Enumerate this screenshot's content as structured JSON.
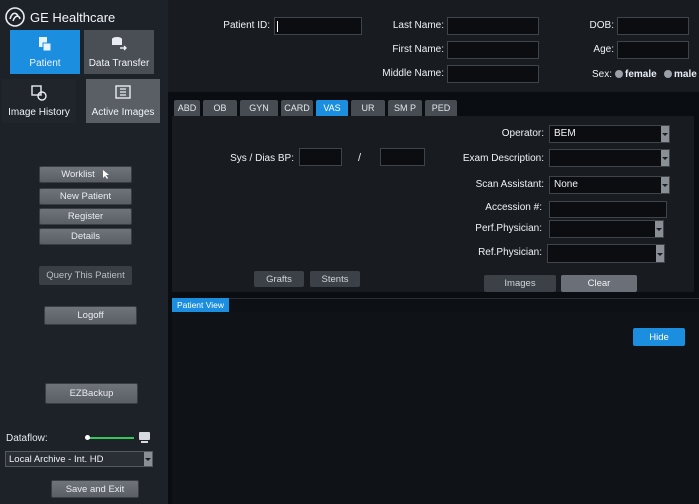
{
  "brand": {
    "name": "GE Healthcare"
  },
  "nav": {
    "patient": "Patient",
    "data_transfer": "Data Transfer",
    "image_history": "Image History",
    "active_images": "Active Images"
  },
  "sidebar": {
    "worklist": "Worklist",
    "new_patient": "New Patient",
    "register": "Register",
    "details": "Details",
    "query_patient": "Query This Patient",
    "logoff": "Logoff",
    "ezbackup": "EZBackup",
    "dataflow_label": "Dataflow:",
    "dataflow_select": "Local Archive - Int. HD",
    "save_exit": "Save and Exit"
  },
  "header": {
    "patient_id_label": "Patient ID:",
    "patient_id_value": "",
    "last_name_label": "Last Name:",
    "first_name_label": "First Name:",
    "middle_name_label": "Middle Name:",
    "dob_label": "DOB:",
    "age_label": "Age:",
    "sex_label": "Sex:",
    "sex_female": "female",
    "sex_male": "male"
  },
  "tabs": [
    "ABD",
    "OB",
    "GYN",
    "CARD",
    "VAS",
    "UR",
    "SM P",
    "PED"
  ],
  "active_tab": "VAS",
  "form": {
    "bp_label": "Sys / Dias BP:",
    "bp_separator": "/",
    "operator_label": "Operator:",
    "operator_value": "BEM",
    "exam_desc_label": "Exam Description:",
    "exam_desc_value": "",
    "scan_assistant_label": "Scan Assistant:",
    "scan_assistant_value": "None",
    "accession_label": "Accession #:",
    "perf_physician_label": "Perf.Physician:",
    "ref_physician_label": "Ref.Physician:",
    "grafts": "Grafts",
    "stents": "Stents",
    "images": "Images",
    "clear": "Clear"
  },
  "patient_view": {
    "tab": "Patient View",
    "hide": "Hide"
  },
  "colors": {
    "accent": "#1b8ee0",
    "dataflow_line": "#34c759"
  }
}
